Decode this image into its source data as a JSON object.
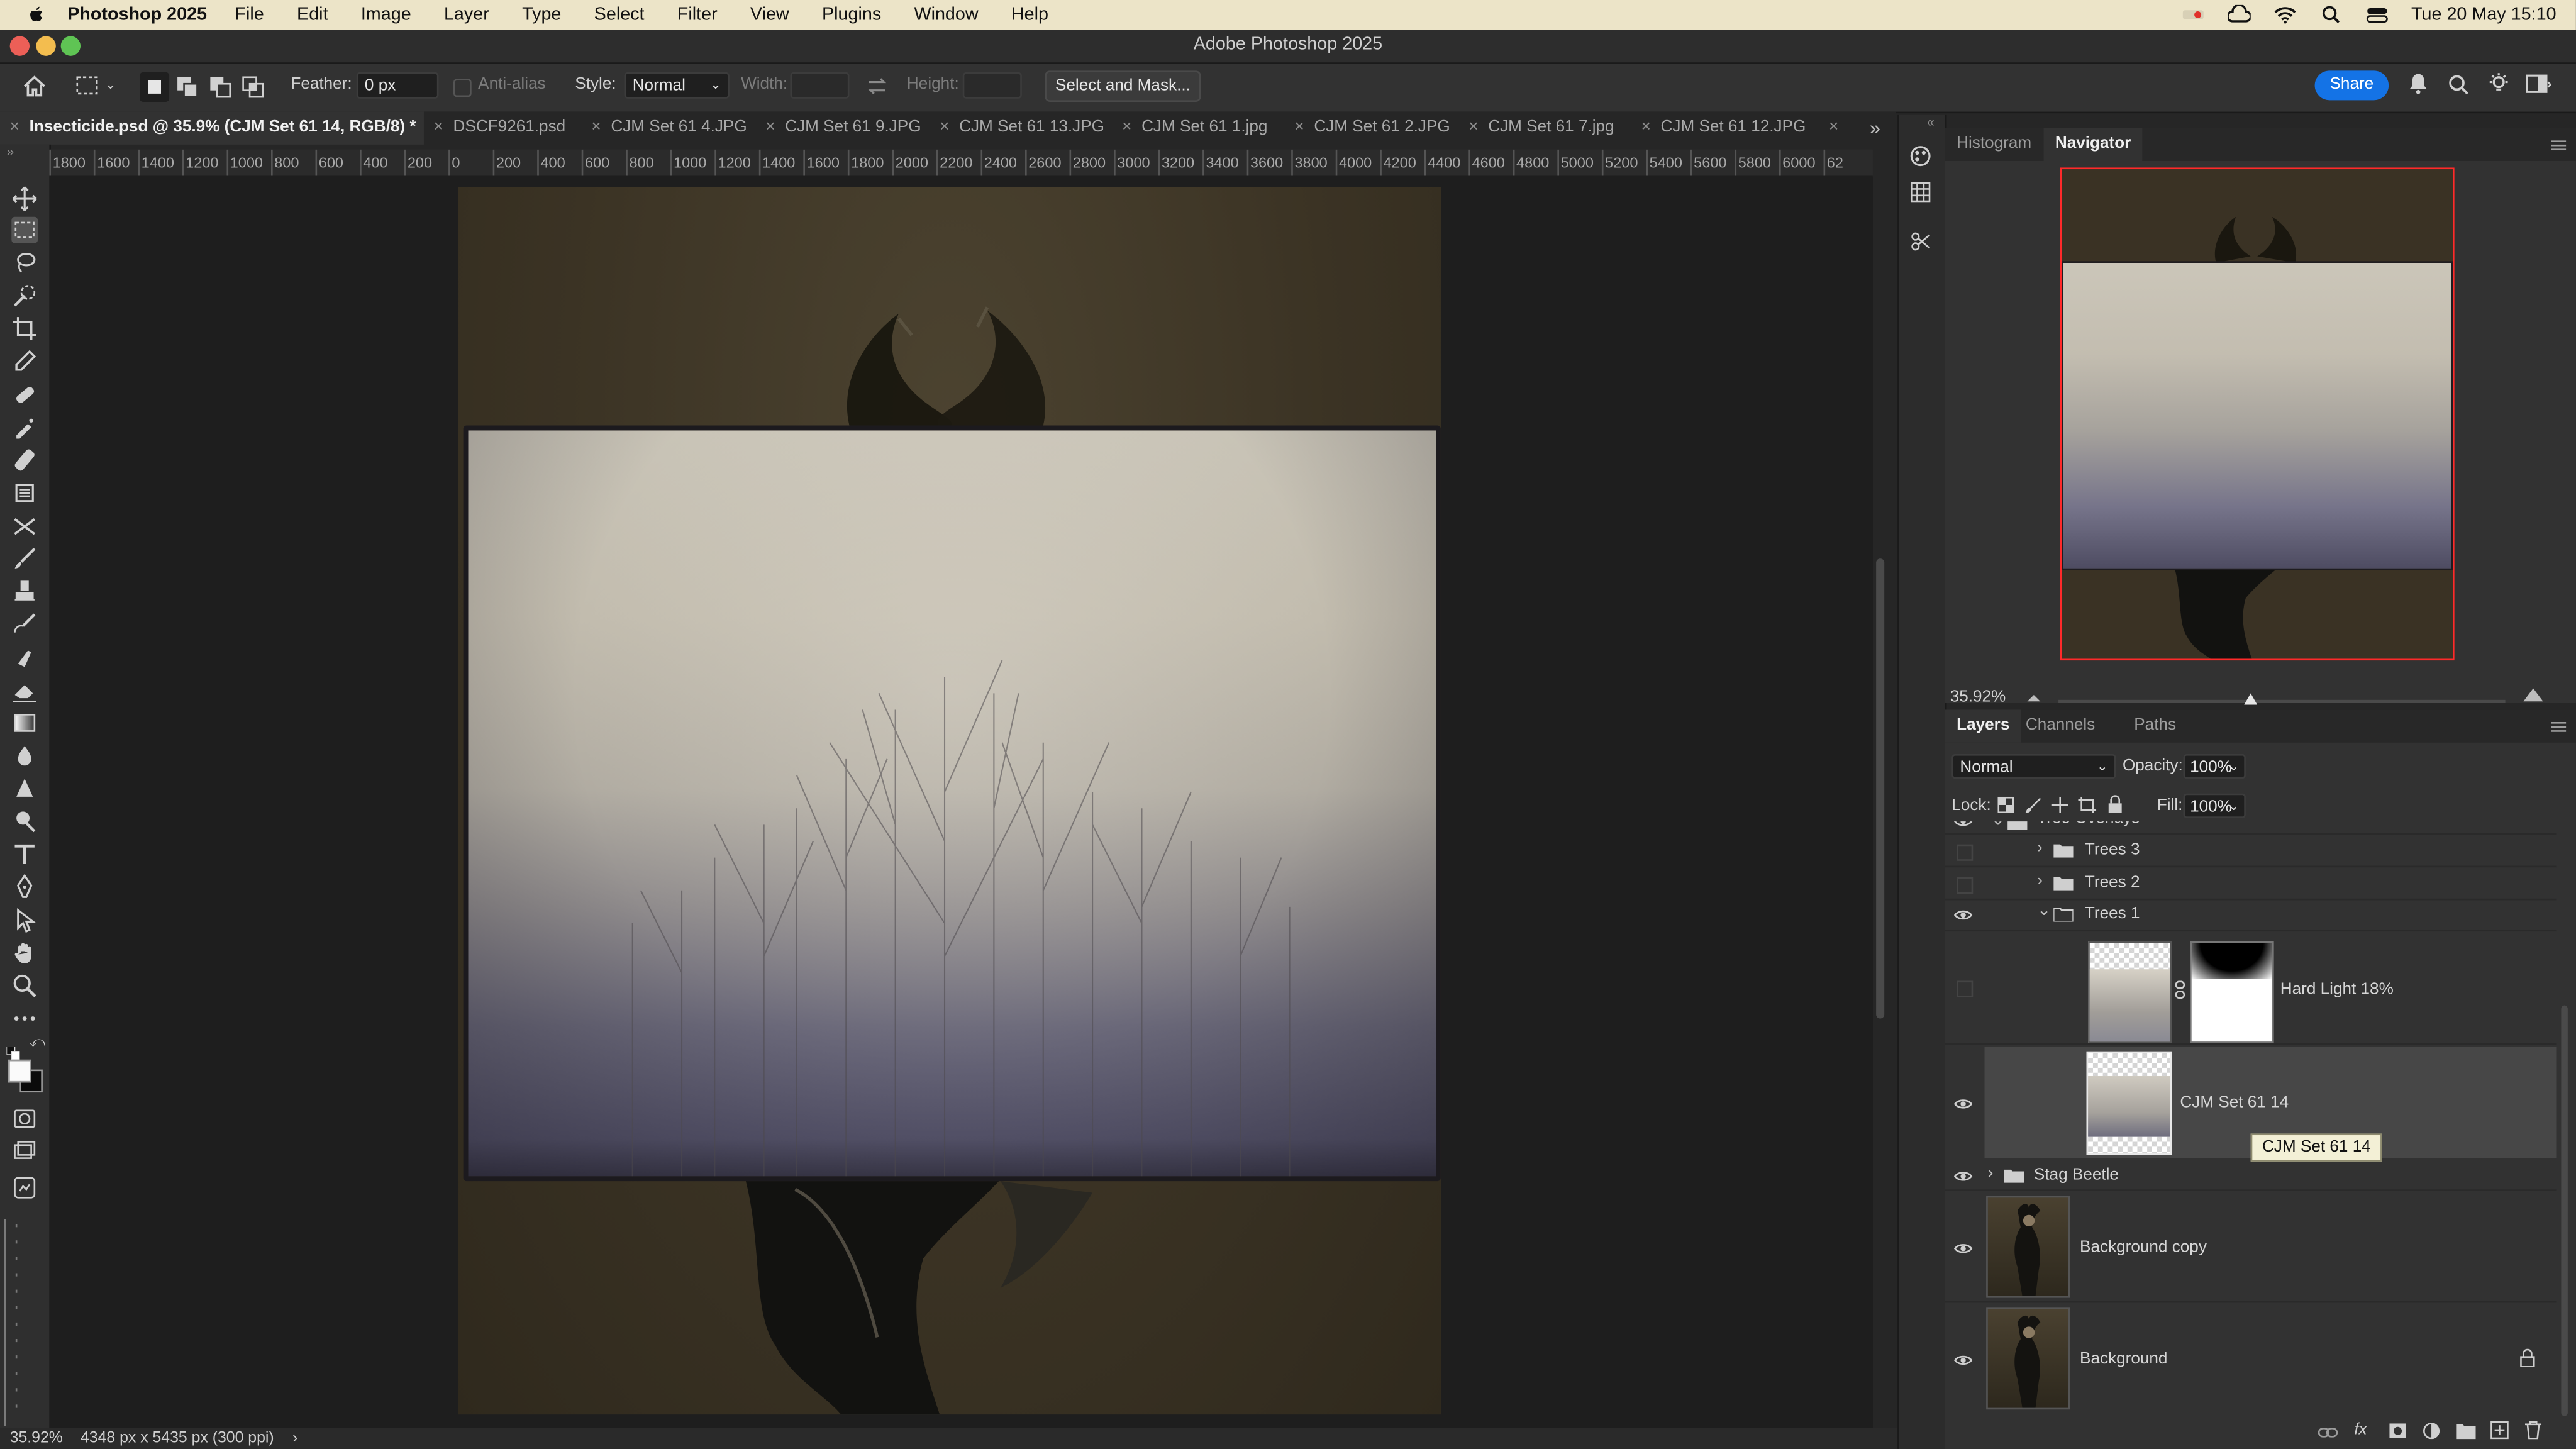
{
  "menubar": {
    "app": "Photoshop 2025",
    "items": [
      "File",
      "Edit",
      "Image",
      "Layer",
      "Type",
      "Select",
      "Filter",
      "View",
      "Plugins",
      "Window",
      "Help"
    ],
    "clock": "Tue 20 May  15:10"
  },
  "window": {
    "title": "Adobe Photoshop 2025"
  },
  "options": {
    "feather_label": "Feather:",
    "feather_value": "0 px",
    "antialias_label": "Anti-alias",
    "style_label": "Style:",
    "style_value": "Normal",
    "width_label": "Width:",
    "height_label": "Height:",
    "select_mask": "Select and Mask...",
    "share": "Share"
  },
  "tabs": [
    "Insecticide.psd @ 35.9% (CJM Set 61 14, RGB/8) *",
    "DSCF9261.psd",
    "CJM Set 61 4.JPG",
    "CJM Set 61 9.JPG",
    "CJM Set 61 13.JPG",
    "CJM Set 61 1.jpg",
    "CJM Set 61 2.JPG",
    "CJM Set 61 7.jpg",
    "CJM Set 61 12.JPG"
  ],
  "ruler_ticks": [
    "1800",
    "1600",
    "1400",
    "1200",
    "1000",
    "800",
    "600",
    "400",
    "200",
    "0",
    "200",
    "400",
    "600",
    "800",
    "1000",
    "1200",
    "1400",
    "1600",
    "1800",
    "2000",
    "2200",
    "2400",
    "2600",
    "2800",
    "3000",
    "3200",
    "3400",
    "3600",
    "3800",
    "4000",
    "4200",
    "4400",
    "4600",
    "4800",
    "5000",
    "5200",
    "5400",
    "5600",
    "5800",
    "6000",
    "62"
  ],
  "status": {
    "zoom": "35.92%",
    "doc_info": "4348 px x 5435 px (300 ppi)"
  },
  "navigator": {
    "tabs": [
      "Histogram",
      "Navigator"
    ],
    "active_tab": "Navigator",
    "zoom": "35.92%",
    "zoom_fraction": 0.43
  },
  "layers_panel": {
    "tabs": [
      "Layers",
      "Channels",
      "Paths"
    ],
    "blend_mode": "Normal",
    "opacity_label": "Opacity:",
    "opacity": "100%",
    "lock_label": "Lock:",
    "fill_label": "Fill:",
    "fill": "100%",
    "layers": [
      {
        "name": "Tree Overlays",
        "visible": true
      },
      {
        "name": "Trees 3",
        "visible": false
      },
      {
        "name": "Trees 2",
        "visible": false
      },
      {
        "name": "Trees 1",
        "visible": true
      },
      {
        "name": "Hard Light 18%",
        "visible": false
      },
      {
        "name": "CJM Set 61 14",
        "visible": true
      },
      {
        "name": "Stag Beetle",
        "visible": true
      },
      {
        "name": "Background copy",
        "visible": true
      },
      {
        "name": "Background",
        "visible": true
      }
    ],
    "tooltip": "CJM Set 61 14"
  },
  "colors": {
    "accent": "#1473e6",
    "menubar": "#ece4c8",
    "navigator_frame": "#ff2a2a"
  }
}
